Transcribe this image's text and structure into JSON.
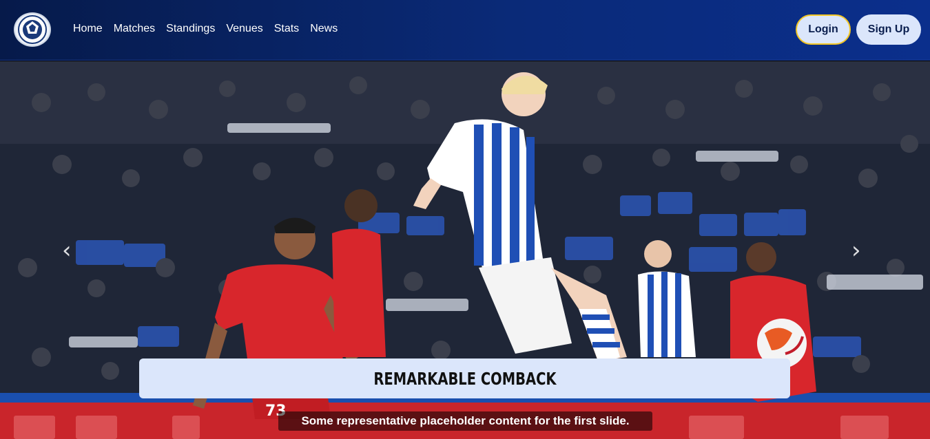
{
  "brand": {
    "logo_icon": "league-ball-crest-icon"
  },
  "nav": {
    "links": [
      "Home",
      "Matches",
      "Standings",
      "Venues",
      "Stats",
      "News"
    ]
  },
  "auth": {
    "login_label": "Login",
    "signup_label": "Sign Up"
  },
  "carousel": {
    "prev_icon": "chevron-left-icon",
    "next_icon": "chevron-right-icon",
    "slide": {
      "title": "REMARKABLE COMBACK",
      "text": "Some representative placeholder content for the first slide."
    }
  },
  "colors": {
    "nav_dark": "#061a4a",
    "nav_light": "#0b2f8c",
    "button_bg": "#dbe6fb",
    "login_border": "#f3c623",
    "home_kit": "#1f4fb5",
    "away_kit": "#d8262c"
  }
}
